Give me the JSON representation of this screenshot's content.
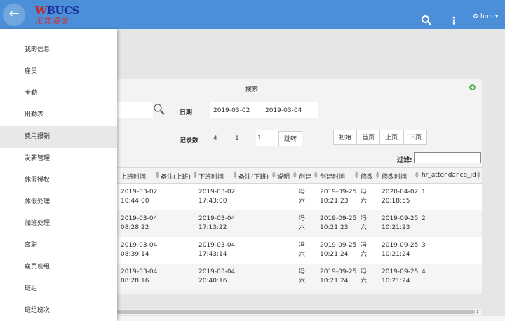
{
  "topbar": {
    "back_icon": "arrow-left-icon",
    "logo_top_a": "W",
    "logo_top_b": "BUCS",
    "logo_bottom": "无忧通信",
    "search_icon": "search-icon",
    "more_icon": "more-vertical-icon",
    "user_label": "hrm",
    "user_icon": "gear-icon",
    "caret": "▾"
  },
  "sidebar": {
    "items": [
      {
        "label": "我的信息"
      },
      {
        "label": "雇员"
      },
      {
        "label": "考勤"
      },
      {
        "label": "出勤表"
      },
      {
        "label": "费用报销"
      },
      {
        "label": "发薪管理"
      },
      {
        "label": "休假授权"
      },
      {
        "label": "休假处理"
      },
      {
        "label": "加班处理"
      },
      {
        "label": "离职"
      },
      {
        "label": "雇员班组"
      },
      {
        "label": "班组"
      },
      {
        "label": "班组班次"
      }
    ]
  },
  "search": {
    "title": "搜索",
    "add_icon": "plus-circle-icon",
    "date_label": "日期",
    "date_from": "2019-03-02",
    "date_to": "2019-03-04"
  },
  "pager": {
    "record_label": "记录数",
    "record_count": "4",
    "page_count": "1",
    "page_value": "1",
    "jump_label": "跳转",
    "first_label": "初始",
    "home_label": "首页",
    "prev_label": "上页",
    "next_label": "下页"
  },
  "filter": {
    "label": "过滤:",
    "value": ""
  },
  "table": {
    "headers": [
      "上班时间",
      "备注(上班)",
      "下班时间",
      "备注(下班)",
      "说明",
      "创建",
      "创建时间",
      "修改",
      "修改时间",
      "hr_attendance_id"
    ],
    "rows": [
      {
        "on_time": "2019-03-02\n10:44:00",
        "off_time": "2019-03-02\n17:43:00",
        "creator": "冯\n六",
        "created": "2019-09-25\n10:21:23",
        "modifier": "冯\n六",
        "modified": "2020-04-02\n20:18:55",
        "id": "1"
      },
      {
        "on_time": "2019-03-04\n08:28:22",
        "off_time": "2019-03-04\n17:13:22",
        "creator": "冯\n六",
        "created": "2019-09-25\n10:21:23",
        "modifier": "冯\n六",
        "modified": "2019-09-25\n10:21:23",
        "id": "2"
      },
      {
        "on_time": "2019-03-04\n08:39:14",
        "off_time": "2019-03-04\n17:43:14",
        "creator": "冯\n六",
        "created": "2019-09-25\n10:21:24",
        "modifier": "冯\n六",
        "modified": "2019-09-25\n10:21:24",
        "id": "3"
      },
      {
        "on_time": "2019-03-04\n08:28:16",
        "off_time": "2019-03-04\n20:40:16",
        "creator": "冯\n六",
        "created": "2019-09-25\n10:21:24",
        "modifier": "冯\n六",
        "modified": "2019-09-25\n10:21:24",
        "id": "4"
      }
    ]
  },
  "scroll": {
    "right_arrow": "›"
  },
  "colors": {
    "topbar": "#4a8fd7",
    "add": "#5cb85c",
    "logo_blue": "#1a2f9a",
    "logo_red": "#d32f2f"
  }
}
